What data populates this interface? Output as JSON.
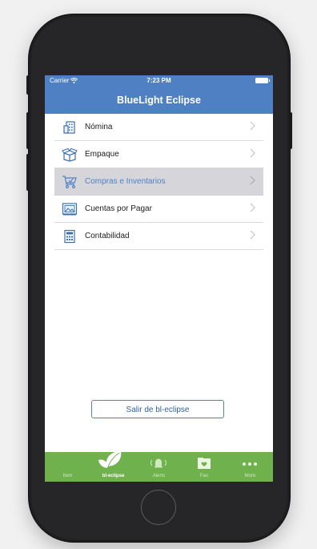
{
  "status": {
    "carrier": "Carrier",
    "time": "7:23 PM"
  },
  "nav": {
    "title": "BlueLight Eclipse"
  },
  "menu": [
    {
      "label": "Nómina",
      "icon": "building-icon"
    },
    {
      "label": "Empaque",
      "icon": "box-icon"
    },
    {
      "label": "Compras e Inventarios",
      "icon": "cart-icon",
      "selected": true
    },
    {
      "label": "Cuentas por Pagar",
      "icon": "picture-frame-icon"
    },
    {
      "label": "Contabilidad",
      "icon": "calculator-icon"
    }
  ],
  "exit_button": {
    "label": "Salir de bl-eclipse"
  },
  "tabs": [
    {
      "label": "Item",
      "icon": "item-icon"
    },
    {
      "label": "bl-eclipse",
      "icon": "leaf-icon",
      "active": true
    },
    {
      "label": "Alerts",
      "icon": "bell-icon"
    },
    {
      "label": "Fav.",
      "icon": "heart-folder-icon"
    },
    {
      "label": "More",
      "icon": "more-icon"
    }
  ],
  "colors": {
    "accent": "#4f80c4",
    "tabbar": "#6fb24d",
    "selected_row": "#d6d6da"
  }
}
